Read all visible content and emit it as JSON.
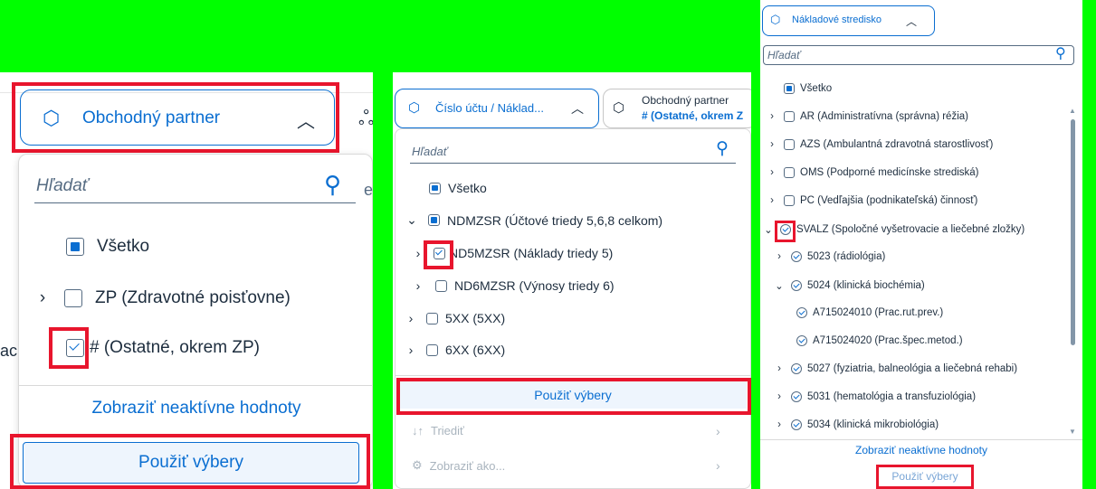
{
  "apply_label": "Použiť výbery",
  "search_placeholder": "Hľadať",
  "show_inactive": "Zobraziť neaktívne hodnoty",
  "panel1": {
    "tab_label": "Obchodný partner",
    "items": [
      {
        "label": "Všetko",
        "state": "partial"
      },
      {
        "label": "ZP (Zdravotné poisťovne)",
        "state": "unchecked"
      },
      {
        "label": "# (Ostatné, okrem ZP)",
        "state": "checked"
      }
    ],
    "side_fragment_1": "e",
    "side_fragment_2": "ac"
  },
  "panel2": {
    "tab_label": "Číslo účtu / Náklad...",
    "tab2_title": "Obchodný partner",
    "tab2_value": "# (Ostatné, okrem Z",
    "items": [
      {
        "label": "Všetko",
        "state": "partial"
      },
      {
        "label": "NDMZSR (Účtové triedy 5,6,8 celkom)",
        "state": "partial"
      },
      {
        "label": "ND5MZSR (Náklady triedy 5)",
        "state": "checked"
      },
      {
        "label": "ND6MZSR (Výnosy triedy 6)",
        "state": "unchecked"
      },
      {
        "label": "5XX (5XX)",
        "state": "unchecked"
      },
      {
        "label": "6XX (6XX)",
        "state": "unchecked"
      }
    ],
    "sort_label": "Triediť",
    "show_as_label": "Zobraziť ako..."
  },
  "panel3": {
    "tab_label": "Nákladové stredisko",
    "items": [
      {
        "label": "Všetko",
        "state": "partial"
      },
      {
        "label": "AR (Administratívna (správna) réžia)",
        "state": "unchecked"
      },
      {
        "label": "AZS (Ambulantná zdravotná starostlivosť)",
        "state": "unchecked"
      },
      {
        "label": "OMS (Podporné medicínske strediská)",
        "state": "unchecked"
      },
      {
        "label": "PC (Vedľajšia (podnikateľská) činnosť)",
        "state": "unchecked"
      },
      {
        "label": "SVALZ (Spoločné vyšetrovacie a liečebné zložky)",
        "state": "checked"
      },
      {
        "label": "5023 (rádiológia)",
        "state": "checked"
      },
      {
        "label": "5024 (klinická biochémia)",
        "state": "checked"
      },
      {
        "label": "A715024010 (Prac.rut.prev.)",
        "state": "checked"
      },
      {
        "label": "A715024020 (Prac.špec.metod.)",
        "state": "checked"
      },
      {
        "label": "5027 (fyziatria, balneológia a liečebná rehabi)",
        "state": "checked"
      },
      {
        "label": "5031 (hematológia a transfuziológia)",
        "state": "checked"
      },
      {
        "label": "5034 (klinická mikrobiológia)",
        "state": "checked"
      }
    ]
  },
  "colors": {
    "accent": "#0a6ed1",
    "highlight_red": "#e8152d",
    "background_green": "#00ff00"
  }
}
